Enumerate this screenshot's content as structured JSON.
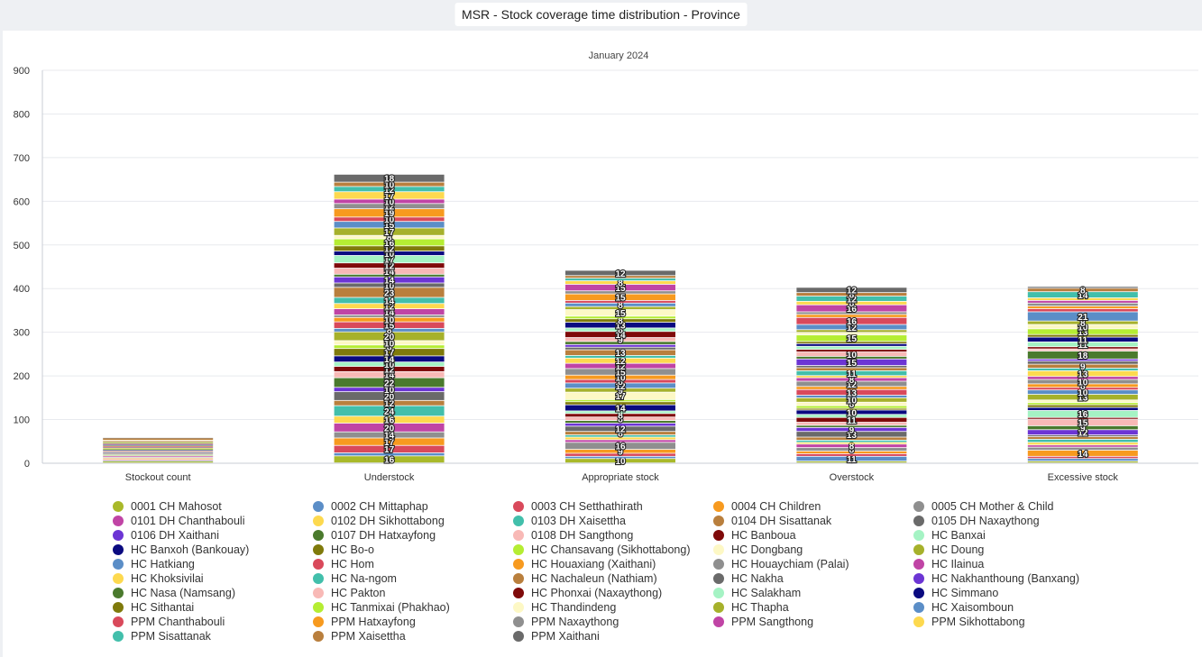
{
  "title": "MSR - Stock coverage time distribution - Province",
  "chart_data": {
    "type": "bar",
    "stacked": true,
    "subtitle": "January 2024",
    "categories": [
      "Stockout count",
      "Understock",
      "Appropriate stock",
      "Overstock",
      "Excessive stock"
    ],
    "ylim": [
      0,
      900
    ],
    "yticks": [
      0,
      100,
      200,
      300,
      400,
      500,
      600,
      700,
      800,
      900
    ],
    "grid": true,
    "legend_position": "bottom",
    "series": [
      {
        "name": "0001 CH Mahosot",
        "color": "#a9b92a",
        "values": [
          4,
          16,
          10,
          4,
          4
        ]
      },
      {
        "name": "0002 CH Mittaphap",
        "color": "#5b8ec7",
        "values": [
          2,
          7,
          5,
          11,
          6
        ]
      },
      {
        "name": "0003 CH Setthathirath",
        "color": "#d9495b",
        "values": [
          2,
          17,
          7,
          6,
          5
        ]
      },
      {
        "name": "0004 CH Children",
        "color": "#f79a1f",
        "values": [
          3,
          17,
          9,
          6,
          14
        ]
      },
      {
        "name": "0005 CH Mother & Child",
        "color": "#8f8f8f",
        "values": [
          2,
          14,
          16,
          8,
          7
        ]
      },
      {
        "name": "0101 DH Chanthabouli",
        "color": "#c044a5",
        "values": [
          3,
          20,
          6,
          8,
          5
        ]
      },
      {
        "name": "0102 DH Sikhottabong",
        "color": "#fdd94f",
        "values": [
          2,
          16,
          6,
          4,
          6
        ]
      },
      {
        "name": "0103 DH Xaisettha",
        "color": "#42bfab",
        "values": [
          1,
          24,
          5,
          5,
          7
        ]
      },
      {
        "name": "0104 DH Sisattanak",
        "color": "#b97f3d",
        "values": [
          2,
          12,
          8,
          7,
          6
        ]
      },
      {
        "name": "0105 DH Naxaythong",
        "color": "#6a6a6a",
        "values": [
          2,
          20,
          12,
          13,
          4
        ]
      },
      {
        "name": "0106 DH Xaithani",
        "color": "#6c35d4",
        "values": [
          1,
          10,
          7,
          9,
          12
        ]
      },
      {
        "name": "0107 DH Hatxayfong",
        "color": "#4a7a2d",
        "values": [
          1,
          22,
          6,
          5,
          9
        ]
      },
      {
        "name": "0108 DH Sangthong",
        "color": "#f8b9b6",
        "values": [
          2,
          14,
          8,
          7,
          15
        ]
      },
      {
        "name": "HC Banboua",
        "color": "#7f0a0a",
        "values": [
          1,
          12,
          8,
          11,
          4
        ]
      },
      {
        "name": "HC Banxai",
        "color": "#a5f3c4",
        "values": [
          2,
          10,
          6,
          7,
          16
        ]
      },
      {
        "name": "HC Banxoh (Bankouay)",
        "color": "#0a0a80",
        "values": [
          1,
          14,
          14,
          10,
          7
        ]
      },
      {
        "name": "HC Bo-o",
        "color": "#7f7a0b",
        "values": [
          1,
          17,
          7,
          4,
          6
        ]
      },
      {
        "name": "HC Chansavang (Sikhottabong)",
        "color": "#b5ed33",
        "values": [
          1,
          8,
          5,
          6,
          5
        ]
      },
      {
        "name": "HC Dongbang",
        "color": "#fdf8c5",
        "values": [
          1,
          10,
          17,
          8,
          6
        ]
      },
      {
        "name": "HC Doung",
        "color": "#a6b12b",
        "values": [
          1,
          20,
          9,
          10,
          13
        ]
      },
      {
        "name": "HC Hatkiang",
        "color": "#5b8ec7",
        "values": [
          1,
          8,
          12,
          6,
          10
        ]
      },
      {
        "name": "HC Hom",
        "color": "#d9495b",
        "values": [
          1,
          15,
          8,
          13,
          6
        ]
      },
      {
        "name": "HC Houaxiang (Xaithani)",
        "color": "#f79a1f",
        "values": [
          1,
          10,
          10,
          7,
          8
        ]
      },
      {
        "name": "HC Houaychiam (Palai)",
        "color": "#8f8f8f",
        "values": [
          0,
          6,
          15,
          12,
          10
        ]
      },
      {
        "name": "HC Ilainua",
        "color": "#c044a5",
        "values": [
          1,
          14,
          12,
          8,
          7
        ]
      },
      {
        "name": "HC Khoksivilai",
        "color": "#fdd94f",
        "values": [
          0,
          12,
          12,
          5,
          13
        ]
      },
      {
        "name": "HC Na-ngom",
        "color": "#42bfab",
        "values": [
          1,
          14,
          6,
          11,
          6
        ]
      },
      {
        "name": "HC Nachaleun (Nathiam)",
        "color": "#b97f3d",
        "values": [
          1,
          23,
          13,
          7,
          9
        ]
      },
      {
        "name": "HC Nakha",
        "color": "#6a6a6a",
        "values": [
          1,
          10,
          6,
          5,
          7
        ]
      },
      {
        "name": "HC Nakhanthoung (Banxang)",
        "color": "#6c35d4",
        "values": [
          1,
          14,
          6,
          15,
          5
        ]
      },
      {
        "name": "HC Nasa (Namsang)",
        "color": "#4a7a2d",
        "values": [
          0,
          6,
          7,
          6,
          18
        ]
      },
      {
        "name": "HC Pakton",
        "color": "#f8b9b6",
        "values": [
          1,
          14,
          9,
          10,
          5
        ]
      },
      {
        "name": "HC Phonxai (Naxaythong)",
        "color": "#7f0a0a",
        "values": [
          1,
          12,
          14,
          6,
          5
        ]
      },
      {
        "name": "HC Salakham",
        "color": "#a5f3c4",
        "values": [
          1,
          17,
          8,
          7,
          11
        ]
      },
      {
        "name": "HC Simmano",
        "color": "#0a0a80",
        "values": [
          0,
          10,
          13,
          6,
          11
        ]
      },
      {
        "name": "HC Sithantai",
        "color": "#7f7a0b",
        "values": [
          1,
          12,
          8,
          5,
          6
        ]
      },
      {
        "name": "HC Tanmixai (Phakhao)",
        "color": "#b5ed33",
        "values": [
          1,
          16,
          6,
          15,
          13
        ]
      },
      {
        "name": "HC Thandindeng",
        "color": "#fdf8c5",
        "values": [
          0,
          8,
          15,
          6,
          10
        ]
      },
      {
        "name": "HC Thapha",
        "color": "#a6b12b",
        "values": [
          1,
          17,
          7,
          6,
          8
        ]
      },
      {
        "name": "HC Xaisomboun",
        "color": "#5b8ec7",
        "values": [
          0,
          15,
          8,
          12,
          21
        ]
      },
      {
        "name": "PPM Chanthabouli",
        "color": "#d9495b",
        "values": [
          1,
          10,
          6,
          16,
          7
        ]
      },
      {
        "name": "PPM Hatxayfong",
        "color": "#f79a1f",
        "values": [
          0,
          19,
          15,
          7,
          6
        ]
      },
      {
        "name": "PPM Naxaythong",
        "color": "#8f8f8f",
        "values": [
          1,
          12,
          7,
          6,
          7
        ]
      },
      {
        "name": "PPM Sangthong",
        "color": "#c044a5",
        "values": [
          0,
          10,
          15,
          16,
          6
        ]
      },
      {
        "name": "PPM Sikhottabong",
        "color": "#fdd94f",
        "values": [
          1,
          17,
          8,
          8,
          6
        ]
      },
      {
        "name": "PPM Sisattanak",
        "color": "#42bfab",
        "values": [
          0,
          12,
          6,
          12,
          14
        ]
      },
      {
        "name": "PPM Xaisettha",
        "color": "#b97f3d",
        "values": [
          5,
          10,
          6,
          8,
          8
        ]
      },
      {
        "name": "PPM Xaithani",
        "color": "#6a6a6a",
        "values": [
          1,
          18,
          12,
          12,
          4
        ]
      }
    ]
  }
}
